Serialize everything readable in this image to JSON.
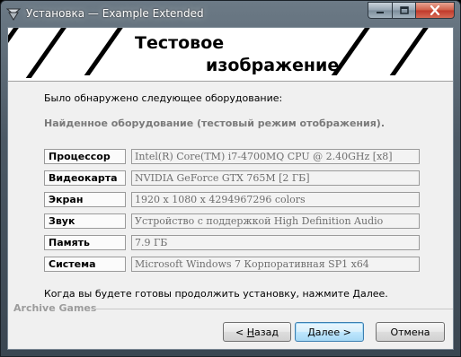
{
  "window": {
    "title": "Установка — Example Extended",
    "controls": {
      "minimize": "minimize-icon",
      "maximize": "maximize-icon",
      "close": "close-icon"
    }
  },
  "banner": {
    "title_line1": "Тестовое",
    "title_line2": "изображение"
  },
  "intro": "Было обнаружено следующее оборудование:",
  "notice": "Найденное оборудование (тестовый режим отображения).",
  "hardware": [
    {
      "label": "Процессор",
      "value": "Intel(R) Core(TM) i7-4700MQ CPU @ 2.40GHz [x8]"
    },
    {
      "label": "Видеокарта",
      "value": "NVIDIA GeForce GTX 765M [2 ГБ]"
    },
    {
      "label": "Экран",
      "value": "1920 x 1080 x 4294967296 colors"
    },
    {
      "label": "Звук",
      "value": "Устройство с поддержкой High Definition Audio"
    },
    {
      "label": "Память",
      "value": "7.9 ГБ"
    },
    {
      "label": "Система",
      "value": "Microsoft Windows 7 Корпоративная SP1 x64"
    }
  ],
  "footer_text": "Когда вы будете готовы продолжить установку, нажмите Далее.",
  "brand": "Archive Games",
  "buttons": {
    "back_prefix": "< ",
    "back_hotkey": "Н",
    "back_rest": "азад",
    "next": "Далее >",
    "cancel": "Отмена"
  }
}
